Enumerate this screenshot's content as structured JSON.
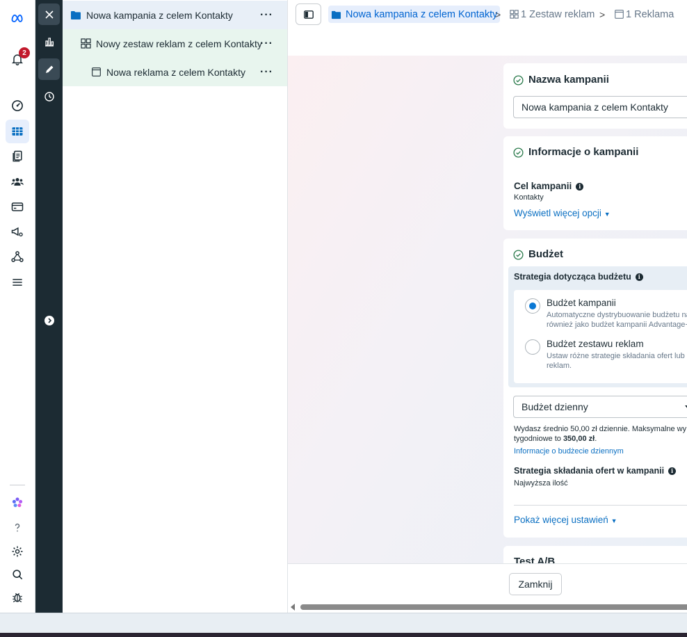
{
  "notifications": {
    "count": "2"
  },
  "tree": {
    "campaign": "Nowa kampania z celem Kontakty",
    "adset": "Nowy zestaw reklam z celem Kontakty",
    "ad": "Nowa reklama z celem Kontakty",
    "more": "···"
  },
  "breadcrumb": {
    "campaign": "Nowa kampania z celem Kontakty",
    "adsets": "1 Zestaw reklam",
    "ads": "1 Reklama",
    "sep": ">"
  },
  "campaign_name": {
    "title": "Nazwa kampanii",
    "value": "Nowa kampania z celem Kontakty"
  },
  "campaign_info": {
    "title": "Informacje o kampanii",
    "objective_label": "Cel kampanii",
    "objective_value": "Kontakty",
    "more_options": "Wyświetl więcej opcji"
  },
  "budget": {
    "title": "Budżet",
    "strategy_label": "Strategia dotycząca budżetu",
    "opt1_title": "Budżet kampanii",
    "opt1_desc1": "Automatyczne dystrybuowanie budżetu na",
    "opt1_desc2": "również jako budżet kampanii Advantage+.",
    "opt2_title": "Budżet zestawu reklam",
    "opt2_desc1": "Ustaw różne strategie składania ofert lub h",
    "opt2_desc2": "reklam.",
    "budget_type": "Budżet dzienny",
    "spend_line1": "Wydasz średnio 50,00 zł dziennie. Maksymalne wy",
    "spend_line2_pre": "tygodniowe to ",
    "spend_line2_bold": "350,00 zł",
    "spend_line2_post": ".",
    "daily_budget_link": "Informacje o budżecie dziennym",
    "bid_strategy_label": "Strategia składania ofert w kampanii",
    "bid_strategy_value": "Najwyższa ilość",
    "show_more": "Pokaż więcej ustawień"
  },
  "ab_test": {
    "title": "Test A/B"
  },
  "footer": {
    "close": "Zamknij"
  },
  "colors": {
    "accent": "#0a78d4",
    "link": "#0a6fc2",
    "dark_rail": "#1c2b33",
    "badge": "#c2182b"
  }
}
